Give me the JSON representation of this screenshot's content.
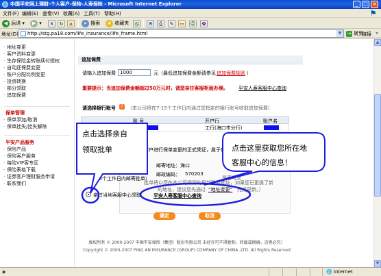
{
  "window": {
    "title": "中国平安网上理财-个人客户-保险-人寿保险 - Microsoft Internet Explorer"
  },
  "menubar": {
    "items": [
      "文件(F)",
      "编辑(E)",
      "查看(V)",
      "收藏(A)",
      "工具(T)",
      "帮助(H)"
    ]
  },
  "toolbar": {
    "back_label": "后退",
    "search_label": "搜索",
    "favorites_label": "收藏夹"
  },
  "addressbar": {
    "label": "地址(D)",
    "url": "http://stg.pa18.com/life_insurance/life_frame.html",
    "go_label": "转到",
    "links_label": "链接"
  },
  "sidebar": {
    "items_top": [
      "地址变更",
      "客户资料变更",
      "生存保险金转账续付授权",
      "自动还保费变更",
      "账户分配比例变更",
      "投资转换",
      "部分领取",
      "追加保费"
    ],
    "section_policy": "保单管理",
    "items_policy": [
      "保单添加/取消",
      "保单挂失/挂失解除"
    ],
    "section_service": "平安产品服务",
    "items_service": [
      "保险产品",
      "保险客户服务",
      "每险VIP客专区",
      "保险表格下载",
      "证券客户理财服务申请",
      "联系我们"
    ]
  },
  "main": {
    "section_title": "追加保费",
    "amount_label": "请输入追加保费",
    "amount_value": "1000",
    "amount_unit": "元（最低追加保费金额请参见",
    "amount_link": "追加保费规则",
    "amount_tail": "）",
    "notice_red": "重要提示：当追加保费金额超过50万元时，请您亲往客服柜面办理。",
    "center_link": "平安人寿客服中心查询",
    "bank_label": "请选择银行账号",
    "bank_note": "（本公司将在7-15个工作日内通过您指定的银行账号收取追加保费）",
    "table_headers": [
      "账  号",
      "开户行",
      "账户名"
    ],
    "table_row_bank": "工行(海口市分行)",
    "panel_line1": "于保险",
    "panel_line2": "客户进行保单变更的正式凭证，属于保险合同的一部分。",
    "panel_line3": "本公司将在变更完成后",
    "panel_line4": "10个工作日内邮寄批单）",
    "mail_addr_label": "邮寄地址：海口",
    "mail_code_label": "邮政编码：",
    "mail_code_value": "570203",
    "mail_note": "的地址，建议您先通过",
    "mail_change_link": "“地址变更”",
    "mail_note_tail": "完成更新。）",
    "mail_note_pre": "是否与您",
    "mail_note_pre2": "批单将以您在本公司保留的最新联系地址，如果您已更换了新",
    "radio_label": "亲往",
    "radio_label2": "当地客服中心领取",
    "radio_link": "平安人寿客服中心查询",
    "confirm_label": "确定",
    "cancel_label": "取消"
  },
  "footer": {
    "line1": "版权所有 © 2000-2007 中国平安保险（集团）股份有限公司 未经许可不得复制、转载或摘编，违者必究！",
    "line2": "Copyright © 2000-2007 PING AN INSURANCE (GROUP) COMPANY OF CHINA ,LTD. All Rights Reserved"
  },
  "status": {
    "zone": "Internet"
  },
  "annotations": {
    "callout_left": [
      "点击选择亲自",
      "领取批单"
    ],
    "callout_right": [
      "点击这里获取您所在地",
      "客服中心的信息！"
    ]
  }
}
